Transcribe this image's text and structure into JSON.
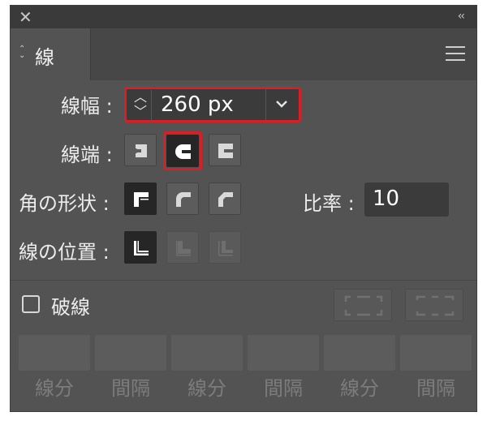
{
  "panel": {
    "title": "線",
    "stroke_weight": {
      "label": "線幅 :",
      "value": "260 px"
    },
    "cap": {
      "label": "線端 :",
      "options": [
        "butt-cap",
        "round-cap",
        "projecting-cap"
      ],
      "selected": "round-cap"
    },
    "corner": {
      "label": "角の形状 :",
      "options": [
        "miter-join",
        "round-join",
        "bevel-join"
      ],
      "selected": "miter-join",
      "limit_label": "比率 :",
      "limit_value": "10"
    },
    "align": {
      "label": "線の位置 :",
      "options": [
        "align-center",
        "align-inside",
        "align-outside"
      ],
      "selected": "align-center"
    },
    "dashed": {
      "label": "破線",
      "checked": false,
      "fields": [
        {
          "label": "線分"
        },
        {
          "label": "間隔"
        },
        {
          "label": "線分"
        },
        {
          "label": "間隔"
        },
        {
          "label": "線分"
        },
        {
          "label": "間隔"
        }
      ]
    }
  },
  "colors": {
    "panel_bg": "#535353",
    "highlight": "#d81f26",
    "selected_btn": "#262626"
  }
}
